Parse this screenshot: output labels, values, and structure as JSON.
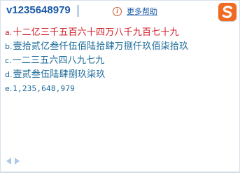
{
  "input": {
    "composition": "v1235648979"
  },
  "help": {
    "icon": "info-icon",
    "icon_glyph": "i",
    "label": "更多帮助"
  },
  "logo": {
    "icon": "sogou-logo-icon",
    "glyph": "S"
  },
  "candidates": [
    {
      "index": "a.",
      "text": "十二亿三千五百六十四万八千九百七十九"
    },
    {
      "index": "b.",
      "text": "壹拾贰亿叁仟伍佰陆拾肆万捌仟玖佰柒拾玖"
    },
    {
      "index": "c.",
      "text": "一二三五六四八九七九"
    },
    {
      "index": "d.",
      "text": "壹贰叁伍陆肆捌玖柒玖"
    },
    {
      "index": "e.",
      "text": "1,235,648,979"
    }
  ],
  "colors": {
    "input_text": "#1a5aa6",
    "selected_candidate": "#d0202a",
    "candidate": "#1a6a9a",
    "logo_bg": "#f06a22",
    "nav_arrow": "#a9c8ea"
  }
}
